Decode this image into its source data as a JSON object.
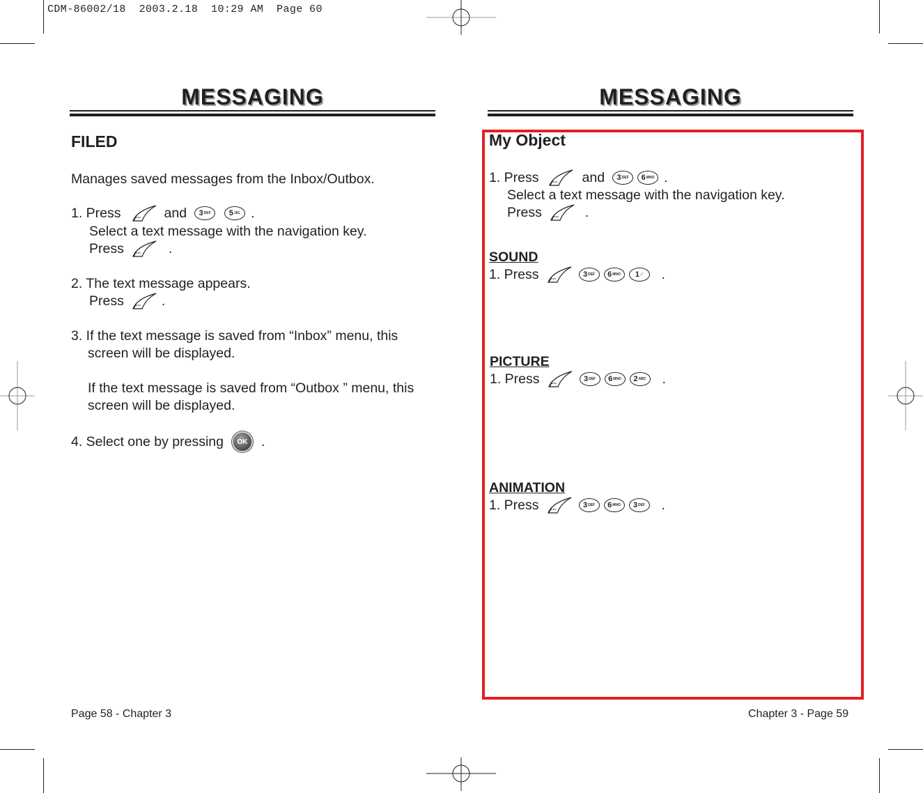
{
  "print_slug": "CDM-86002/18  2003.2.18  10:29 AM  Page 60",
  "left_page": {
    "title": "MESSAGING",
    "section_heading": "FILED",
    "intro": "Manages saved messages from the Inbox/Outbox.",
    "step1": {
      "prefix": "1. Press",
      "and": "and",
      "keys": [
        {
          "num": "3",
          "letters": "DEF"
        },
        {
          "num": "5",
          "letters": "JKL"
        }
      ],
      "end": ".",
      "line2": "Select a text message with the navigation key.",
      "line3_prefix": "Press",
      "line3_end": "."
    },
    "step2": {
      "line1": "2. The text message appears.",
      "line2_prefix": "Press",
      "line2_end": "."
    },
    "step3": {
      "line1": "3. If the text message is saved from “Inbox” menu, this",
      "line2": "screen will be displayed.",
      "line3": "If the text message is saved from “Outbox ” menu, this",
      "line4": "screen will be displayed."
    },
    "step4": {
      "prefix": "4. Select one by pressing",
      "ok_label": "OK",
      "end": "."
    },
    "footer": "Page 58 - Chapter 3"
  },
  "right_page": {
    "title": "MESSAGING",
    "section_heading": "My Object",
    "step1": {
      "prefix": "1. Press",
      "and": "and",
      "keys": [
        {
          "num": "3",
          "letters": "DEF"
        },
        {
          "num": "6",
          "letters": "MNO"
        }
      ],
      "end": ".",
      "line2": "Select a text message with the navigation key.",
      "line3_prefix": "Press",
      "line3_end": "."
    },
    "subsections": [
      {
        "heading": "SOUND",
        "prefix": "1. Press",
        "keys": [
          {
            "num": "3",
            "letters": "DEF"
          },
          {
            "num": "6",
            "letters": "MNO"
          },
          {
            "num": "1",
            "letters": ".-'"
          }
        ],
        "end": "."
      },
      {
        "heading": "PICTURE",
        "prefix": "1. Press",
        "keys": [
          {
            "num": "3",
            "letters": "DEF"
          },
          {
            "num": "6",
            "letters": "MNO"
          },
          {
            "num": "2",
            "letters": "ABC"
          }
        ],
        "end": "."
      },
      {
        "heading": "ANIMATION",
        "prefix": "1. Press",
        "keys": [
          {
            "num": "3",
            "letters": "DEF"
          },
          {
            "num": "6",
            "letters": "MNO"
          },
          {
            "num": "3",
            "letters": "DEF"
          }
        ],
        "end": "."
      }
    ],
    "highlight_color": "#e31e25",
    "footer": "Chapter 3 - Page 59"
  }
}
